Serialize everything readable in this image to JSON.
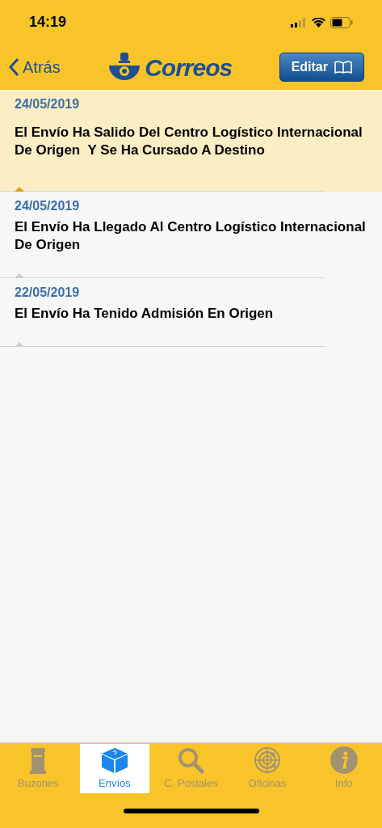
{
  "status_bar": {
    "time": "14:19"
  },
  "nav": {
    "back": "Atrás",
    "logo": "Correos",
    "edit": "Editar"
  },
  "events": [
    {
      "date": "24/05/2019",
      "text": "El Envío Ha Salido Del Centro Logístico Internacional De Origen  Y Se Ha Cursado A Destino",
      "selected": true
    },
    {
      "date": "24/05/2019",
      "text": "El Envío Ha Llegado Al Centro Logístico Internacional De Origen",
      "selected": false
    },
    {
      "date": "22/05/2019",
      "text": "El Envío Ha Tenido Admisión En Origen",
      "selected": false
    }
  ],
  "tabs": [
    {
      "kind": "mailbox",
      "label": "Buzones",
      "selected": false
    },
    {
      "kind": "package",
      "label": "Envíos",
      "selected": true
    },
    {
      "kind": "search",
      "label": "C. Postales",
      "selected": false
    },
    {
      "kind": "radar",
      "label": "Oficinas",
      "selected": false
    },
    {
      "kind": "info",
      "label": "Info",
      "selected": false
    }
  ]
}
